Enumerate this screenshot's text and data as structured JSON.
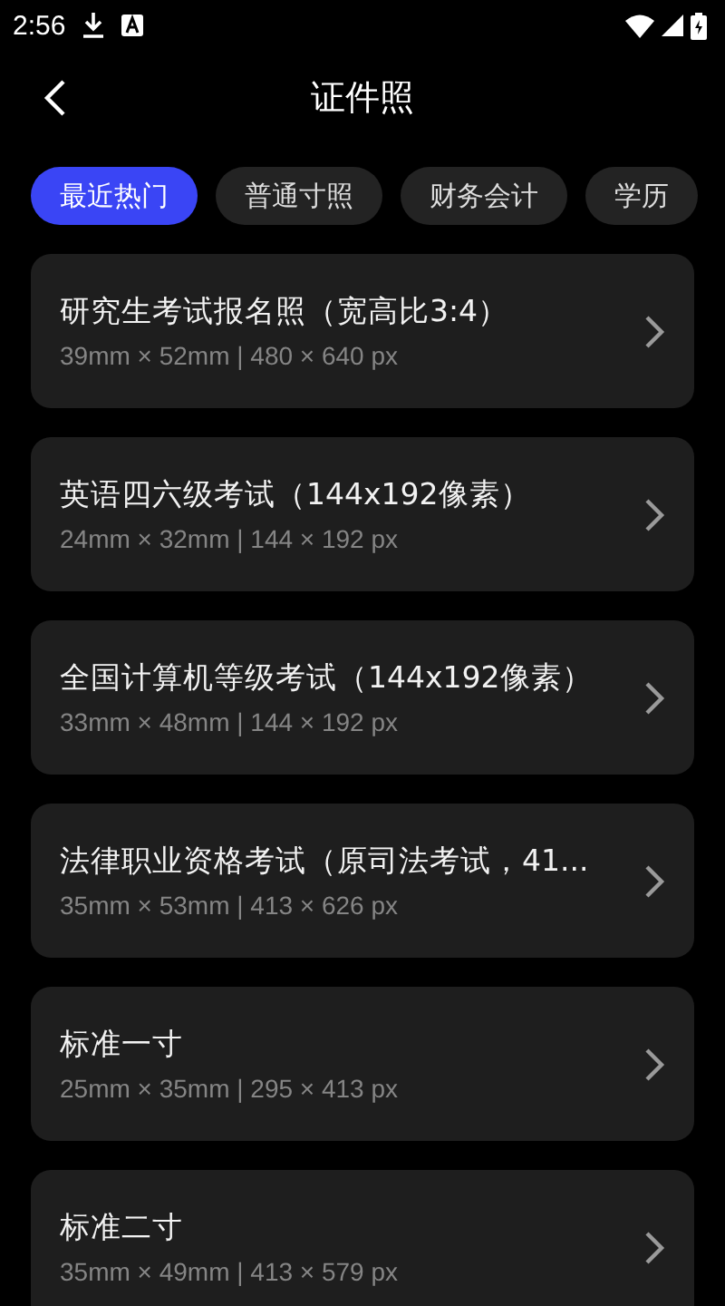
{
  "status_bar": {
    "time": "2:56"
  },
  "header": {
    "title": "证件照"
  },
  "tabs": [
    {
      "label": "最近热门",
      "selected": true
    },
    {
      "label": "普通寸照",
      "selected": false
    },
    {
      "label": "财务会计",
      "selected": false
    },
    {
      "label": "学历",
      "selected": false
    }
  ],
  "items": [
    {
      "title": "研究生考试报名照（宽高比3:4）",
      "spec": "39mm × 52mm | 480 × 640 px"
    },
    {
      "title": "英语四六级考试（144x192像素）",
      "spec": "24mm × 32mm | 144 × 192 px"
    },
    {
      "title": "全国计算机等级考试（144x192像素）",
      "spec": "33mm × 48mm | 144 × 192 px"
    },
    {
      "title": "法律职业资格考试（原司法考试，41...",
      "spec": "35mm × 53mm | 413 × 626 px"
    },
    {
      "title": "标准一寸",
      "spec": "25mm × 35mm | 295 × 413 px"
    },
    {
      "title": "标准二寸",
      "spec": "35mm × 49mm | 413 × 579 px"
    }
  ]
}
